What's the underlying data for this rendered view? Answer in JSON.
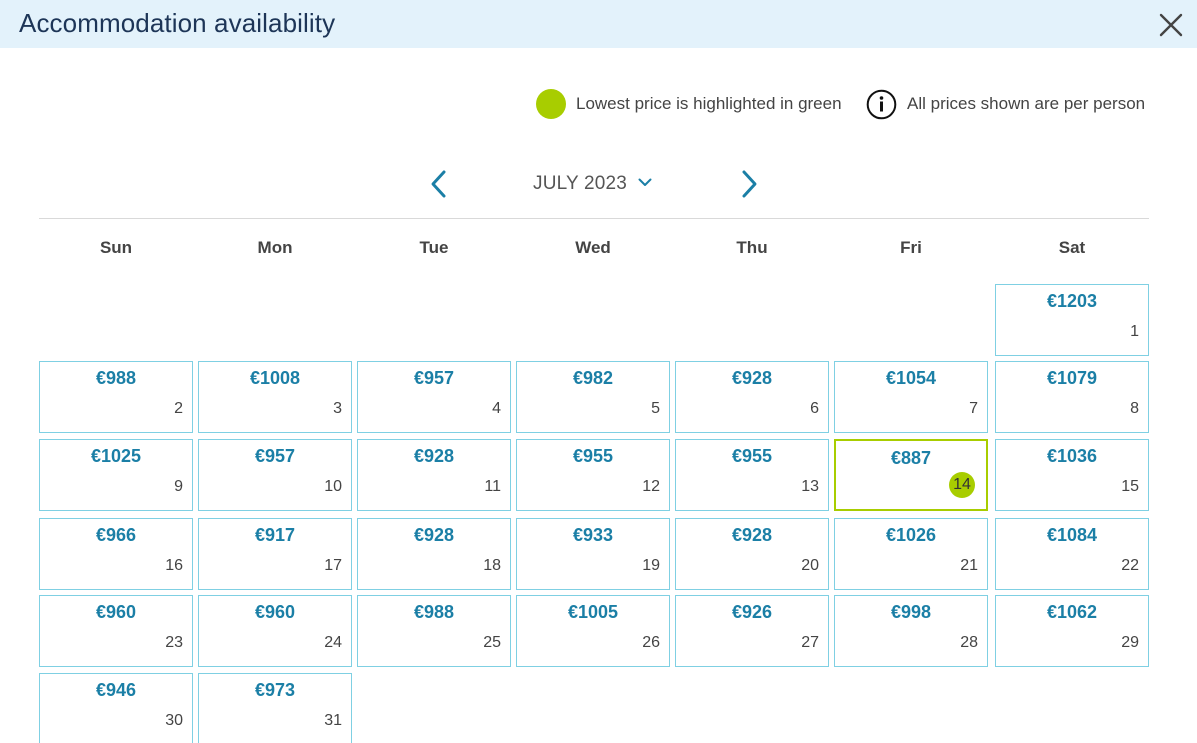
{
  "header": {
    "title": "Accommodation availability",
    "close_icon": "close-icon"
  },
  "legend": {
    "lowest_text": "Lowest price is highlighted in green",
    "lowest_color": "#a8cd00",
    "per_person_text": "All prices shown are per person",
    "info_icon": "info-icon"
  },
  "month_nav": {
    "month_label": "JULY 2023",
    "prev_icon": "chevron-left-icon",
    "next_icon": "chevron-right-icon",
    "dropdown_icon": "chevron-down-icon"
  },
  "weekdays": [
    "Sun",
    "Mon",
    "Tue",
    "Wed",
    "Thu",
    "Fri",
    "Sat"
  ],
  "colors": {
    "accent": "#1b7fa6",
    "cell_border": "#7fd0e3",
    "header_bg": "#e3f2fb",
    "lowest": "#a8cd00"
  },
  "days": [
    {
      "day": "1",
      "price": "€1203",
      "weekday": "Sat"
    },
    {
      "day": "2",
      "price": "€988",
      "weekday": "Sun"
    },
    {
      "day": "3",
      "price": "€1008",
      "weekday": "Mon"
    },
    {
      "day": "4",
      "price": "€957",
      "weekday": "Tue"
    },
    {
      "day": "5",
      "price": "€982",
      "weekday": "Wed"
    },
    {
      "day": "6",
      "price": "€928",
      "weekday": "Thu"
    },
    {
      "day": "7",
      "price": "€1054",
      "weekday": "Fri"
    },
    {
      "day": "8",
      "price": "€1079",
      "weekday": "Sat"
    },
    {
      "day": "9",
      "price": "€1025",
      "weekday": "Sun"
    },
    {
      "day": "10",
      "price": "€957",
      "weekday": "Mon"
    },
    {
      "day": "11",
      "price": "€928",
      "weekday": "Tue"
    },
    {
      "day": "12",
      "price": "€955",
      "weekday": "Wed"
    },
    {
      "day": "13",
      "price": "€955",
      "weekday": "Thu"
    },
    {
      "day": "14",
      "price": "€887",
      "weekday": "Fri",
      "lowest": true
    },
    {
      "day": "15",
      "price": "€1036",
      "weekday": "Sat"
    },
    {
      "day": "16",
      "price": "€966",
      "weekday": "Sun"
    },
    {
      "day": "17",
      "price": "€917",
      "weekday": "Mon"
    },
    {
      "day": "18",
      "price": "€928",
      "weekday": "Tue"
    },
    {
      "day": "19",
      "price": "€933",
      "weekday": "Wed"
    },
    {
      "day": "20",
      "price": "€928",
      "weekday": "Thu"
    },
    {
      "day": "21",
      "price": "€1026",
      "weekday": "Fri"
    },
    {
      "day": "22",
      "price": "€1084",
      "weekday": "Sat"
    },
    {
      "day": "23",
      "price": "€960",
      "weekday": "Sun"
    },
    {
      "day": "24",
      "price": "€960",
      "weekday": "Mon"
    },
    {
      "day": "25",
      "price": "€988",
      "weekday": "Tue"
    },
    {
      "day": "26",
      "price": "€1005",
      "weekday": "Wed"
    },
    {
      "day": "27",
      "price": "€926",
      "weekday": "Thu"
    },
    {
      "day": "28",
      "price": "€998",
      "weekday": "Fri"
    },
    {
      "day": "29",
      "price": "€1062",
      "weekday": "Sat"
    },
    {
      "day": "30",
      "price": "€946",
      "weekday": "Sun"
    },
    {
      "day": "31",
      "price": "€973",
      "weekday": "Mon"
    }
  ]
}
